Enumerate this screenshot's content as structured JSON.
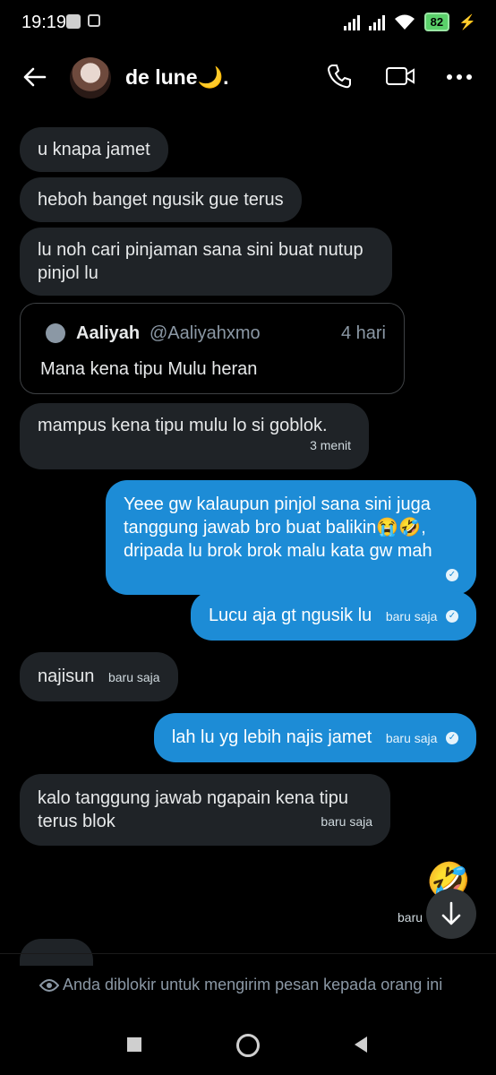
{
  "status_bar": {
    "time": "19:19",
    "battery": "82"
  },
  "header": {
    "title": "de lune🌙."
  },
  "messages": [
    {
      "text": "u knapa jamet"
    },
    {
      "text": "heboh banget ngusik gue terus"
    },
    {
      "text": "lu noh cari pinjaman sana sini buat nutup pinjol lu"
    },
    {
      "text": "mampus kena tipu mulu lo si goblok.",
      "time": "3 menit"
    },
    {
      "text": "Yeee gw kalaupun pinjol sana sini juga tanggung jawab bro buat balikin😭🤣, dripada lu brok brok malu kata gw mah"
    },
    {
      "text": "Lucu aja gt ngusik lu",
      "time": "baru saja"
    },
    {
      "text": "najisun",
      "time": "baru saja"
    },
    {
      "text": "lah lu yg lebih najis jamet",
      "time": "baru saja"
    },
    {
      "text": "kalo tanggung jawab ngapain kena tipu terus blok",
      "time": "baru saja"
    },
    {
      "text": "🤣",
      "time": "baru"
    }
  ],
  "quote": {
    "name": "Aaliyah",
    "handle": "@Aaliyahxmo",
    "age": "4 hari",
    "text": "Mana kena tipu Mulu heran"
  },
  "footer": {
    "blocked_notice": "Anda diblokir untuk mengirim pesan kepada orang ini"
  },
  "colors": {
    "outgoing_bubble": "#1d8cd6",
    "incoming_bubble": "#1f2327",
    "background": "#000000"
  }
}
